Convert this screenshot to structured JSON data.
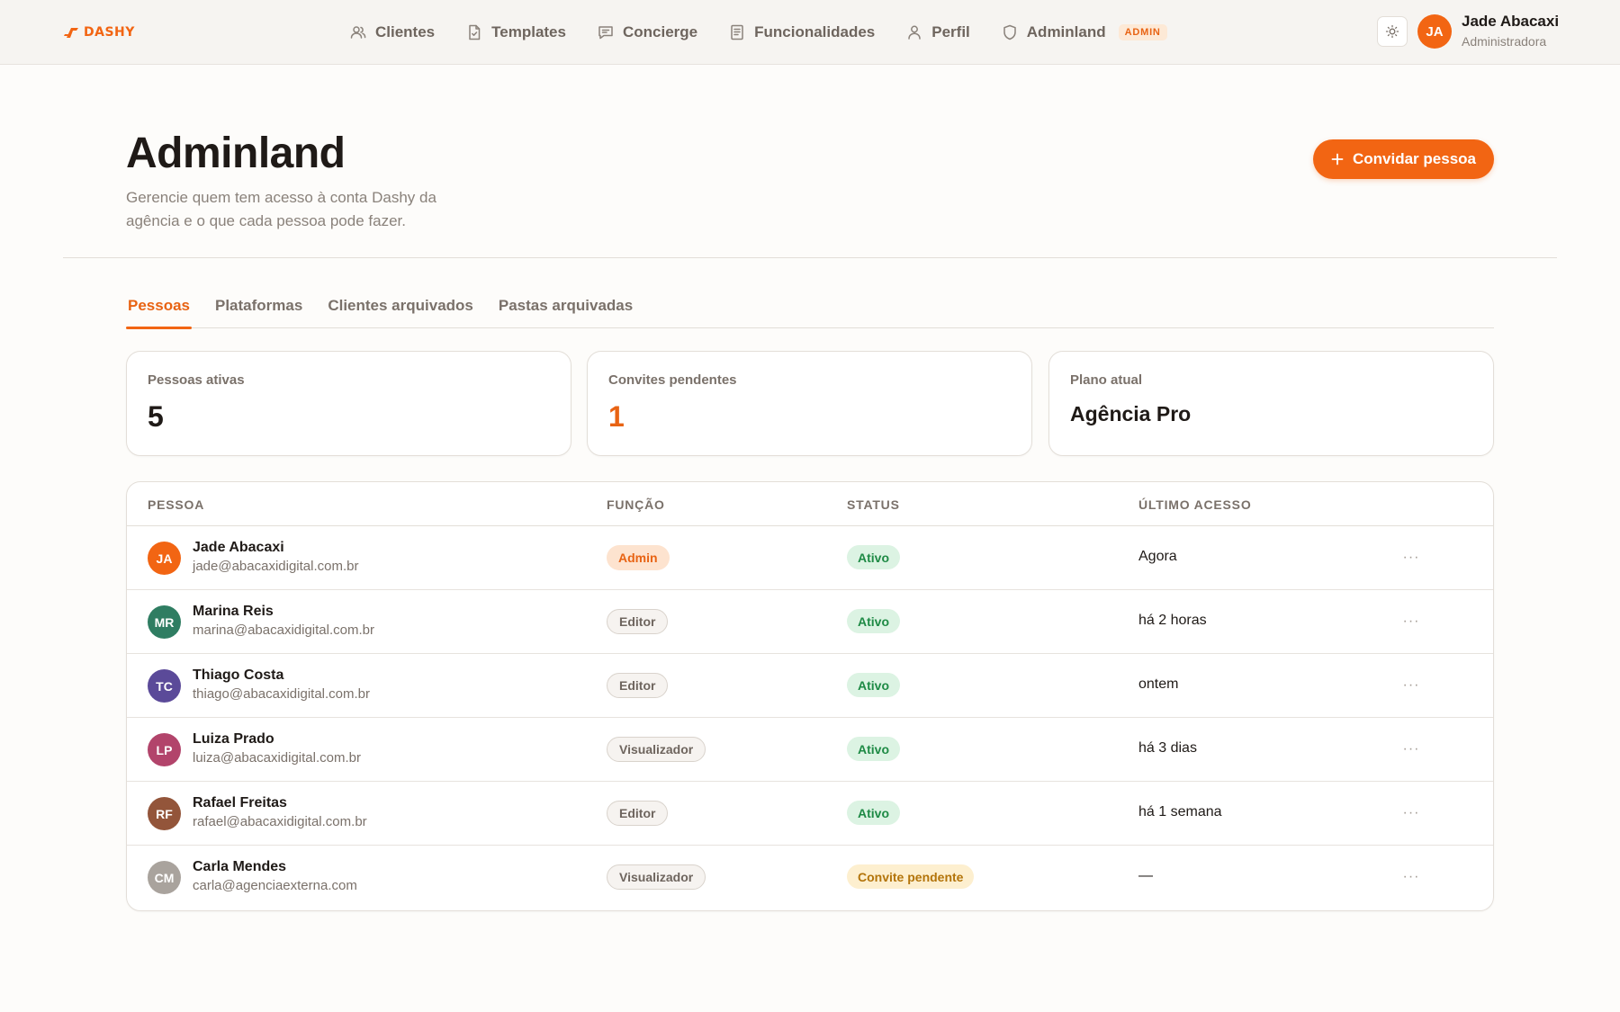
{
  "brand": {
    "name": "DASHY",
    "accent": "#f26513"
  },
  "nav": {
    "items": [
      {
        "label": "Clientes",
        "icon": "users-icon"
      },
      {
        "label": "Templates",
        "icon": "file-check-icon"
      },
      {
        "label": "Concierge",
        "icon": "chat-icon"
      },
      {
        "label": "Funcionalidades",
        "icon": "document-icon"
      },
      {
        "label": "Perfil",
        "icon": "user-icon"
      },
      {
        "label": "Adminland",
        "icon": "shield-icon"
      }
    ],
    "admin_badge": "ADMIN"
  },
  "user": {
    "initials": "JA",
    "name": "Jade Abacaxi",
    "role": "Administradora"
  },
  "header": {
    "title": "Adminland",
    "subtitle": "Gerencie quem tem acesso à conta Dashy da agência e o que cada pessoa pode fazer.",
    "invite_label": "Convidar pessoa"
  },
  "tabs": [
    "Pessoas",
    "Plataformas",
    "Clientes arquivados",
    "Pastas arquivadas"
  ],
  "active_tab": "Pessoas",
  "stats": {
    "active": {
      "label": "Pessoas ativas",
      "value": "5"
    },
    "pending": {
      "label": "Convites pendentes",
      "value": "1"
    },
    "plan": {
      "label": "Plano atual",
      "value": "Agência Pro"
    }
  },
  "table": {
    "headers": [
      "PESSOA",
      "FUNÇÃO",
      "STATUS",
      "ÚLTIMO ACESSO"
    ],
    "rows": [
      {
        "initials": "JA",
        "name": "Jade Abacaxi",
        "email": "jade@abacaxidigital.com.br",
        "role": "Admin",
        "status": "Ativo",
        "last_access": "Agora",
        "avatar_color": "#f26513"
      },
      {
        "initials": "MR",
        "name": "Marina Reis",
        "email": "marina@abacaxidigital.com.br",
        "role": "Editor",
        "status": "Ativo",
        "last_access": "há 2 horas",
        "avatar_color": "#2f7d62"
      },
      {
        "initials": "TC",
        "name": "Thiago Costa",
        "email": "thiago@abacaxidigital.com.br",
        "role": "Editor",
        "status": "Ativo",
        "last_access": "ontem",
        "avatar_color": "#5b4a99"
      },
      {
        "initials": "LP",
        "name": "Luiza Prado",
        "email": "luiza@abacaxidigital.com.br",
        "role": "Visualizador",
        "status": "Ativo",
        "last_access": "há 3 dias",
        "avatar_color": "#b2446b"
      },
      {
        "initials": "RF",
        "name": "Rafael Freitas",
        "email": "rafael@abacaxidigital.com.br",
        "role": "Editor",
        "status": "Ativo",
        "last_access": "há 1 semana",
        "avatar_color": "#93553a"
      },
      {
        "initials": "CM",
        "name": "Carla Mendes",
        "email": "carla@agenciaexterna.com",
        "role": "Visualizador",
        "status": "Convite pendente",
        "last_access": "—",
        "avatar_color": "#a9a39d"
      }
    ],
    "row_menu": "···"
  }
}
